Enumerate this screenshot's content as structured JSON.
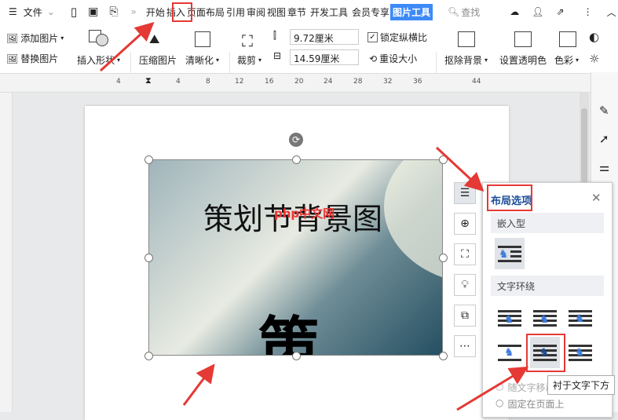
{
  "menubar": {
    "file": "文件",
    "tabs": [
      "开始",
      "插入",
      "页面布局",
      "引用",
      "审阅",
      "视图",
      "章节",
      "开发工具",
      "会员专享",
      "图片工具"
    ],
    "search": "查找"
  },
  "ribbon": {
    "add_image": "添加图片",
    "replace_image": "替换图片",
    "insert_shape": "插入形状",
    "compress": "压缩图片",
    "sharpen": "清晰化",
    "crop": "裁剪",
    "height": "9.72厘米",
    "width": "14.59厘米",
    "lock_ratio": "锁定纵横比",
    "reset_size": "重设大小",
    "remove_bg": "抠除背景",
    "transparent": "设置透明色",
    "color": "色彩"
  },
  "ruler": {
    "ticks": [
      "4",
      "4",
      "8",
      "12",
      "16",
      "20",
      "24",
      "28",
      "32",
      "36",
      "44"
    ]
  },
  "image": {
    "title": "策划节背景图",
    "big_char": "策",
    "watermark": "php中文网"
  },
  "panel": {
    "title": "布局选项",
    "inline": "嵌入型",
    "wrap": "文字环绕",
    "tooltip": "衬于文字下方",
    "move_with_text": "随文字移动",
    "fix_on_page": "固定在页面上"
  },
  "colors": {
    "accent": "#3d8af7",
    "highlight": "#e53935"
  }
}
